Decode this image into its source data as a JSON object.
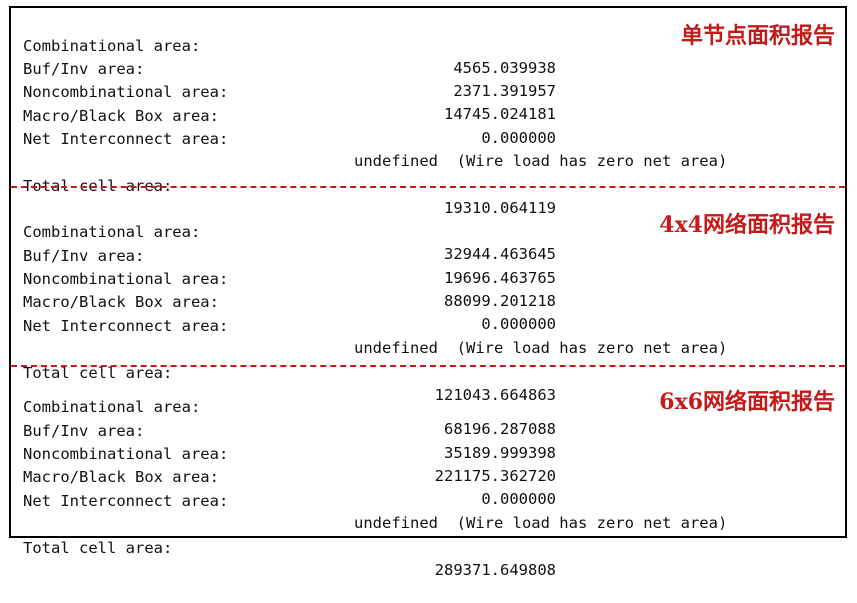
{
  "sections": [
    {
      "title": "单节点面积报告",
      "rows": [
        {
          "label": "Combinational area:",
          "value": "4565.039938"
        },
        {
          "label": "Buf/Inv area:",
          "value": "2371.391957"
        },
        {
          "label": "Noncombinational area:",
          "value": "14745.024181"
        },
        {
          "label": "Macro/Black Box area:",
          "value": "0.000000"
        },
        {
          "label": "Net Interconnect area:",
          "value": "undefined  (Wire load has zero net area)"
        }
      ],
      "total": {
        "label": "Total cell area:",
        "value": "19310.064119"
      }
    },
    {
      "title": "4x4网络面积报告",
      "rows": [
        {
          "label": "Combinational area:",
          "value": "32944.463645"
        },
        {
          "label": "Buf/Inv area:",
          "value": "19696.463765"
        },
        {
          "label": "Noncombinational area:",
          "value": "88099.201218"
        },
        {
          "label": "Macro/Black Box area:",
          "value": "0.000000"
        },
        {
          "label": "Net Interconnect area:",
          "value": "undefined  (Wire load has zero net area)"
        }
      ],
      "total": {
        "label": "Total cell area:",
        "value": "121043.664863"
      }
    },
    {
      "title": "6x6网络面积报告",
      "rows": [
        {
          "label": "Combinational area:",
          "value": "68196.287088"
        },
        {
          "label": "Buf/Inv area:",
          "value": "35189.999398"
        },
        {
          "label": "Noncombinational area:",
          "value": "221175.362720"
        },
        {
          "label": "Macro/Black Box area:",
          "value": "0.000000"
        },
        {
          "label": "Net Interconnect area:",
          "value": "undefined  (Wire load has zero net area)"
        }
      ],
      "total": {
        "label": "Total cell area:",
        "value": "289371.649808"
      }
    }
  ],
  "colors": {
    "accent": "#c41a1a",
    "border": "#000000",
    "text": "#111111"
  }
}
